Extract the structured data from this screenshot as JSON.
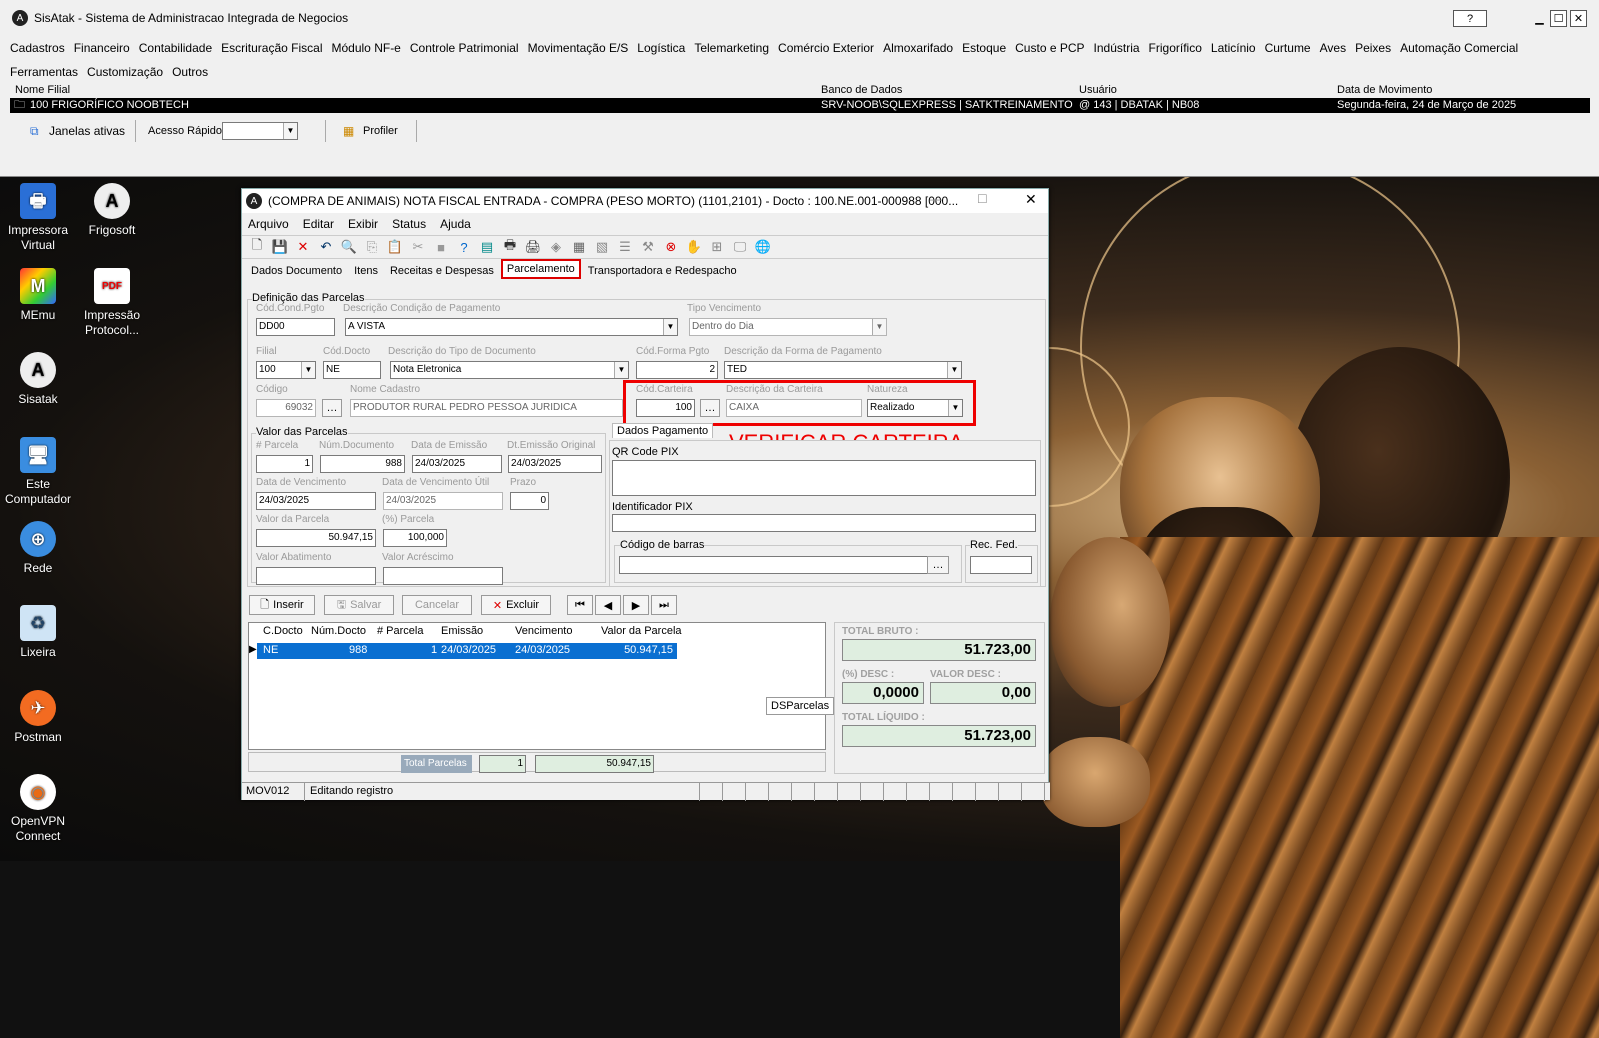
{
  "app": {
    "title": "SisAtak - Sistema de Administracao Integrada de Negocios",
    "help": "?",
    "min": "▁",
    "max": "☐",
    "close": "✕"
  },
  "menu": [
    "Cadastros",
    "Financeiro",
    "Contabilidade",
    "Escrituração Fiscal",
    "Módulo NF-e",
    "Controle Patrimonial",
    "Movimentação E/S",
    "Logística",
    "Telemarketing",
    "Comércio Exterior",
    "Almoxarifado",
    "Estoque",
    "Custo e PCP",
    "Indústria",
    "Frigorífico",
    "Laticínio",
    "Curtume",
    "Aves",
    "Peixes",
    "Automação Comercial",
    "Ferramentas",
    "Customização",
    "Outros"
  ],
  "info": {
    "h_filial": "Nome Filial",
    "h_banco": "Banco de Dados",
    "h_usuario": "Usuário",
    "h_data": "Data de Movimento",
    "filial": "100 FRIGORÍFICO NOOBTECH",
    "banco": "SRV-NOOB\\SQLEXPRESS | SATKTREINAMENTO",
    "usuario": "@ 143 | DBATAK | NB08",
    "data": "Segunda-feira, 24 de Março de 2025"
  },
  "quick": {
    "janelas": "Janelas ativas",
    "acesso": "Acesso Rápido",
    "profiler": "Profiler"
  },
  "desktop": [
    {
      "label": "Impressora Virtual"
    },
    {
      "label": "Frigosoft"
    },
    {
      "label": "MEmu"
    },
    {
      "label": "Impressão Protocol..."
    },
    {
      "label": "Sisatak"
    },
    {
      "label": "Este Computador"
    },
    {
      "label": "Rede"
    },
    {
      "label": "Lixeira"
    },
    {
      "label": "Postman"
    },
    {
      "label": "OpenVPN Connect"
    }
  ],
  "win": {
    "title": "(COMPRA DE ANIMAIS) NOTA FISCAL ENTRADA - COMPRA (PESO MORTO) (1101,2101) - Docto : 100.NE.001-000988 [000...",
    "menu": [
      "Arquivo",
      "Editar",
      "Exibir",
      "Status",
      "Ajuda"
    ],
    "tabs": [
      "Dados Documento",
      "Itens",
      "Receitas e Despesas",
      "Parcelamento",
      "Transportadora e Redespacho"
    ],
    "def": "Definição das Parcelas",
    "cod_cond_lbl": "Cód.Cond.Pgto",
    "cod_cond": "DD00",
    "desc_cond_lbl": "Descrição Condição de Pagamento",
    "desc_cond": "A VISTA",
    "tipo_venc_lbl": "Tipo Vencimento",
    "tipo_venc": "Dentro do Dia",
    "filial_lbl": "Filial",
    "filial": "100",
    "cod_docto_lbl": "Cód.Docto",
    "cod_docto": "NE",
    "desc_tipo_lbl": "Descrição do Tipo de Documento",
    "desc_tipo": "Nota Eletronica",
    "cod_forma_lbl": "Cód.Forma Pgto",
    "cod_forma": "2",
    "desc_forma_lbl": "Descrição da Forma de Pagamento",
    "desc_forma": "TED",
    "codigo_lbl": "Código",
    "codigo": "69032",
    "nome_lbl": "Nome Cadastro",
    "nome": "PRODUTOR RURAL PEDRO PESSOA JURIDICA",
    "cod_cart_lbl": "Cód.Carteira",
    "cod_cart": "100",
    "desc_cart_lbl": "Descrição da Carteira",
    "desc_cart": "CAIXA",
    "nat_lbl": "Natureza",
    "nat": "Realizado",
    "valor_parc": "Valor das Parcelas",
    "dados_pag": "Dados Pagamento",
    "verificar": "VERIFICAR CARTEIRA",
    "n_parc_lbl": "# Parcela",
    "n_parc": "1",
    "num_doc_lbl": "Núm.Documento",
    "num_doc": "988",
    "dt_em_lbl": "Data de Emissão",
    "dt_em": "24/03/2025",
    "dt_em_or_lbl": "Dt.Emissão Original",
    "dt_em_or": "24/03/2025",
    "dt_venc_lbl": "Data de Vencimento",
    "dt_venc": "24/03/2025",
    "dt_util_lbl": "Data de Vencimento Útil",
    "dt_util": "24/03/2025",
    "prazo_lbl": "Prazo",
    "prazo": "0",
    "vparc_lbl": "Valor da Parcela",
    "vparc": "50.947,15",
    "pct_lbl": "(%) Parcela",
    "pct": "100,000",
    "abat_lbl": "Valor Abatimento",
    "acr_lbl": "Valor Acréscimo",
    "qr_lbl": "QR Code PIX",
    "id_pix_lbl": "Identificador PIX",
    "barras_lbl": "Código de barras",
    "rec_lbl": "Rec. Fed.",
    "btn_inserir": "Inserir",
    "btn_salvar": "Salvar",
    "btn_cancelar": "Cancelar",
    "btn_excluir": "Excluir",
    "grid_cols": [
      "C.Docto",
      "Núm.Docto",
      "# Parcela",
      "Emissão",
      "Vencimento",
      "Valor da Parcela"
    ],
    "grid_row": [
      "NE",
      "988",
      "1",
      "24/03/2025",
      "24/03/2025",
      "50.947,15"
    ],
    "total_parc_lbl": "Total Parcelas",
    "total_count": "1",
    "total_val": "50.947,15",
    "dsparcelas": "DSParcelas",
    "bruto_lbl": "TOTAL BRUTO :",
    "bruto": "51.723,00",
    "pdesc_lbl": "(%) DESC :",
    "pdesc": "0,0000",
    "vdesc_lbl": "VALOR DESC :",
    "vdesc": "0,00",
    "liq_lbl": "TOTAL LÍQUIDO :",
    "liq": "51.723,00",
    "status_code": "MOV012",
    "status_text": "Editando registro"
  }
}
